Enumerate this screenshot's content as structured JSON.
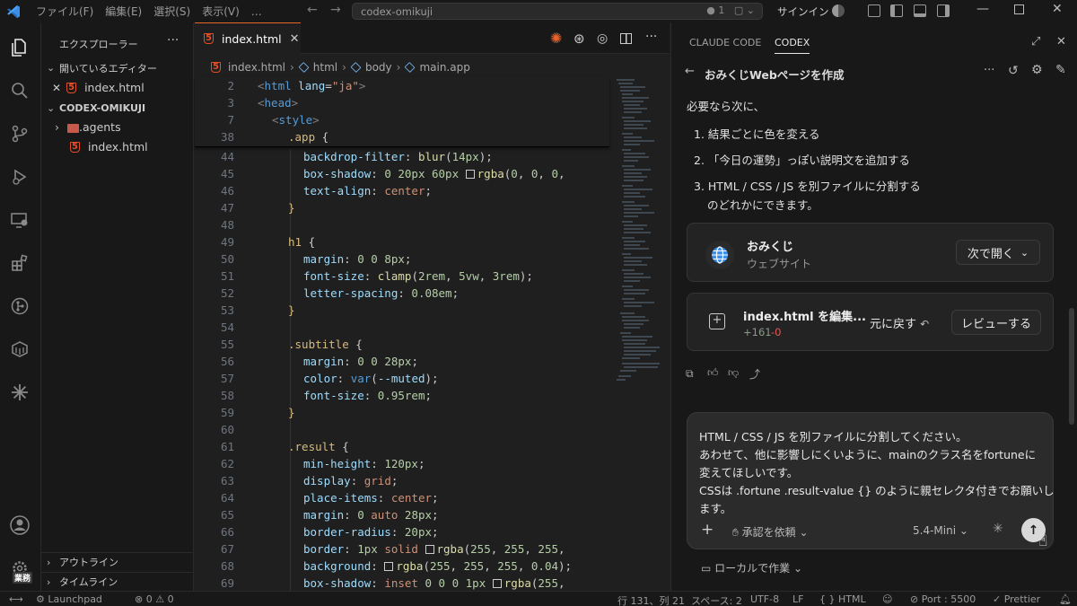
{
  "titlebar": {
    "menus": [
      "ファイル(F)",
      "編集(E)",
      "選択(S)",
      "表示(V)",
      "…"
    ],
    "search_text": "codex-omikuji",
    "notification_count": "● 1",
    "signin": "サインイン"
  },
  "sidebar": {
    "title": "エクスプローラー",
    "open_editors_label": "開いているエディター",
    "open_editor_file": "index.html",
    "project_label": "CODEX-OMIKUJI",
    "tree": [
      ".agents",
      "index.html"
    ],
    "outline_label": "アウトライン",
    "timeline_label": "タイムライン"
  },
  "activity": {
    "badge": "業務"
  },
  "editor": {
    "tab_label": "index.html",
    "breadcrumb": [
      "index.html",
      "html",
      "body",
      "main.app"
    ],
    "sticky_lines": [
      {
        "ln": "2",
        "text": "<html lang=\"ja\">"
      },
      {
        "ln": "3",
        "text": "<head>"
      },
      {
        "ln": "7",
        "text": "<style>"
      },
      {
        "ln": "38",
        "text": ".app {"
      }
    ],
    "line_numbers": [
      "44",
      "45",
      "46",
      "47",
      "48",
      "49",
      "50",
      "51",
      "52",
      "53",
      "54",
      "55",
      "56",
      "57",
      "58",
      "59",
      "60",
      "61",
      "62",
      "63",
      "64",
      "65",
      "66",
      "67",
      "68",
      "69"
    ]
  },
  "panel": {
    "tabs": [
      "CLAUDE CODE",
      "CODEX"
    ],
    "active_tab": "CODEX",
    "conversation_title": "おみくじWebページを作成",
    "intro": "必要なら次に、",
    "options": [
      "1.  結果ごとに色を変える",
      "2.  「今日の運勢」っぽい説明文を追加する",
      "3.  HTML / CSS / JS を別ファイルに分割する"
    ],
    "tail": "のどれかにできます。",
    "website_card": {
      "name": "おみくじ",
      "subtitle": "ウェブサイト",
      "open_btn": "次で開く"
    },
    "edit_card": {
      "title": "index.html を編集...",
      "additions": "+161",
      "deletions": "-0",
      "undo": "元に戻す",
      "review": "レビューする"
    },
    "composer": {
      "lines": [
        "HTML / CSS / JS を別ファイルに分割してください。",
        "あわせて、他に影響しにくいように、mainのクラス名をfortuneに",
        "変えてほしいです。",
        "CSSは .fortune .result-value {} のように親セレクタ付きでお願いし",
        "ます。"
      ],
      "approval": "承認を依頼",
      "model": "5.4-Mini"
    },
    "local_work": "ローカルで作業"
  },
  "statusbar": {
    "launchpad": "Launchpad",
    "problems": "⊗ 0 ⚠ 0",
    "position": "行 131、列 21",
    "spaces": "スペース: 2",
    "encoding": "UTF-8",
    "eol": "LF",
    "language": "{ } HTML",
    "port": "Port : 5500",
    "prettier": "✓ Prettier"
  }
}
